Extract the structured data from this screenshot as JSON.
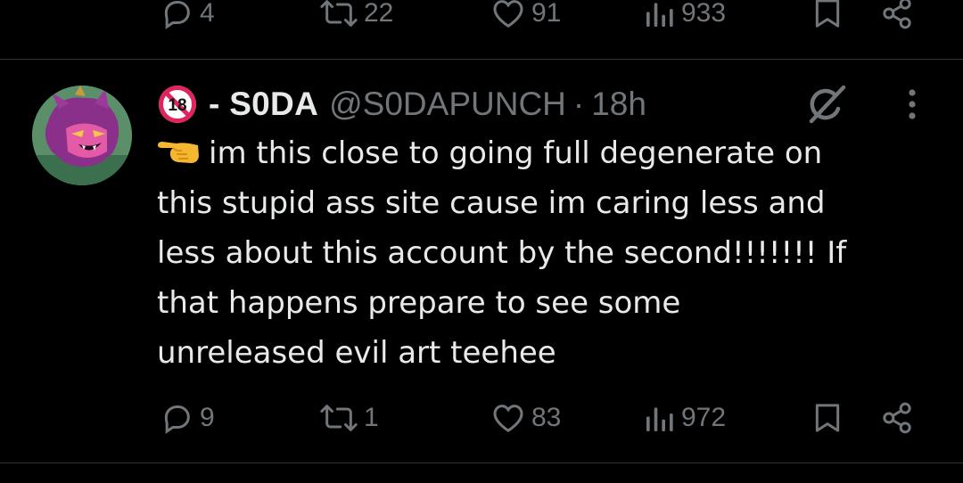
{
  "previous_tweet": {
    "replies": "4",
    "reposts": "22",
    "likes": "91",
    "views": "933"
  },
  "tweet": {
    "display_name": "- S0DA",
    "handle": "@S0DAPUNCH",
    "separator": "·",
    "time": "18h",
    "badge_text": "18",
    "text_lines": [
      "im this close to going full degenerate on",
      "this stupid ass site cause im caring less and",
      "less about this account by the second!!!!!!! If",
      "that happens prepare to see some",
      "unreleased evil art teehee"
    ],
    "replies": "9",
    "reposts": "1",
    "likes": "83",
    "views": "972"
  },
  "colors": {
    "background": "#000000",
    "text_primary": "#e7e9ea",
    "text_secondary": "#71767b",
    "divider": "#2f3336",
    "badge_red": "#e0245e"
  },
  "icons": {
    "reply": "reply-icon",
    "repost": "repost-icon",
    "like": "like-icon",
    "views": "views-icon",
    "bookmark": "bookmark-icon",
    "share": "share-icon",
    "grok": "grok-icon",
    "more": "more-icon",
    "age": "no-under-18-icon",
    "hand": "left-pointing-hand-emoji"
  }
}
